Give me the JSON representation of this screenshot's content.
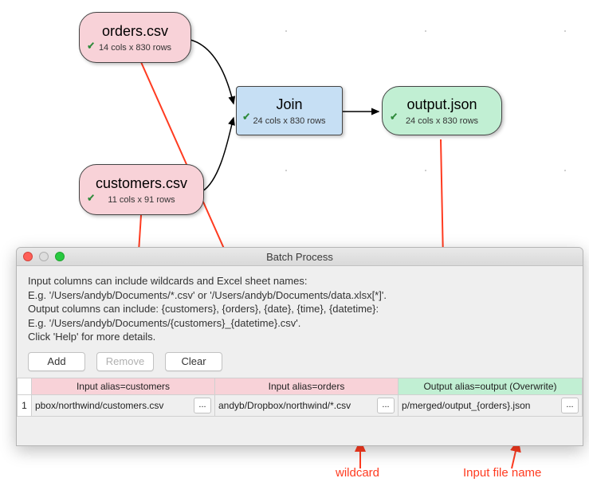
{
  "nodes": {
    "orders": {
      "title": "orders.csv",
      "sub": "14 cols x 830 rows"
    },
    "customers": {
      "title": "customers.csv",
      "sub": "11 cols x 91 rows"
    },
    "join": {
      "title": "Join",
      "sub": "24 cols x 830 rows"
    },
    "output": {
      "title": "output.json",
      "sub": "24 cols x 830 rows"
    }
  },
  "window": {
    "title": "Batch Process",
    "instructions": [
      "Input columns can include wildcards and Excel sheet names:",
      "E.g. '/Users/andyb/Documents/*.csv' or '/Users/andyb/Documents/data.xlsx[*]'.",
      "Output columns can include: {customers}, {orders}, {date}, {time}, {datetime}:",
      "E.g. '/Users/andyb/Documents/{customers}_{datetime}.csv'.",
      "Click 'Help' for more details."
    ],
    "buttons": {
      "add": "Add",
      "remove": "Remove",
      "clear": "Clear"
    },
    "headers": {
      "col1": "Input alias=customers",
      "col2": "Input alias=orders",
      "col3": "Output alias=output (Overwrite)"
    },
    "row1": {
      "num": "1",
      "c1": "pbox/northwind/customers.csv",
      "c2": "andyb/Dropbox/northwind/*.csv",
      "c3": "p/merged/output_{orders}.json"
    },
    "ellipsis": "..."
  },
  "annotations": {
    "wildcard": "wildcard",
    "inputfilename": "Input file name"
  }
}
